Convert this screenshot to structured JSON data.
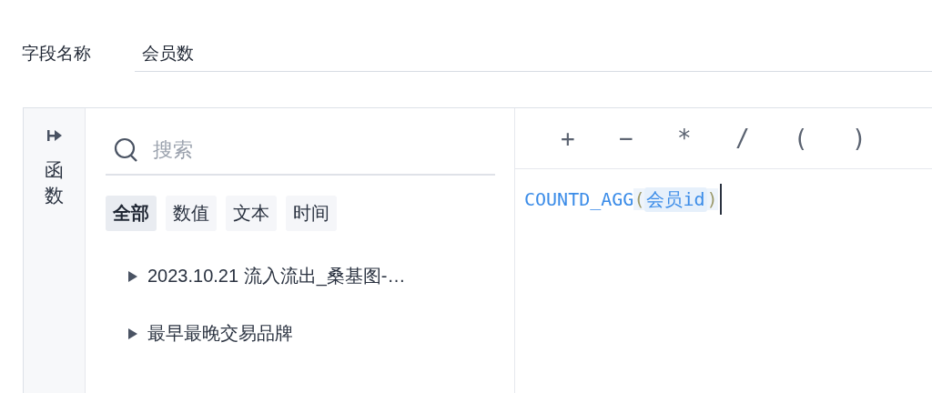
{
  "field_name": {
    "label": "字段名称",
    "value": "会员数"
  },
  "sidebar": {
    "label": "函数"
  },
  "search": {
    "placeholder": "搜索"
  },
  "filters": [
    {
      "label": "全部",
      "selected": true
    },
    {
      "label": "数值",
      "selected": false
    },
    {
      "label": "文本",
      "selected": false
    },
    {
      "label": "时间",
      "selected": false
    }
  ],
  "tree": [
    {
      "label": "2023.10.21 流入流出_桑基图-…",
      "expanded": false
    },
    {
      "label": "最早最晚交易品牌",
      "expanded": false
    }
  ],
  "operators": [
    "+",
    "−",
    "*",
    "/",
    "(",
    ")"
  ],
  "formula": [
    {
      "kind": "function",
      "text": "COUNTD_AGG"
    },
    {
      "kind": "paren",
      "text": "("
    },
    {
      "kind": "field",
      "text": "会员id"
    },
    {
      "kind": "paren",
      "text": ")"
    }
  ]
}
